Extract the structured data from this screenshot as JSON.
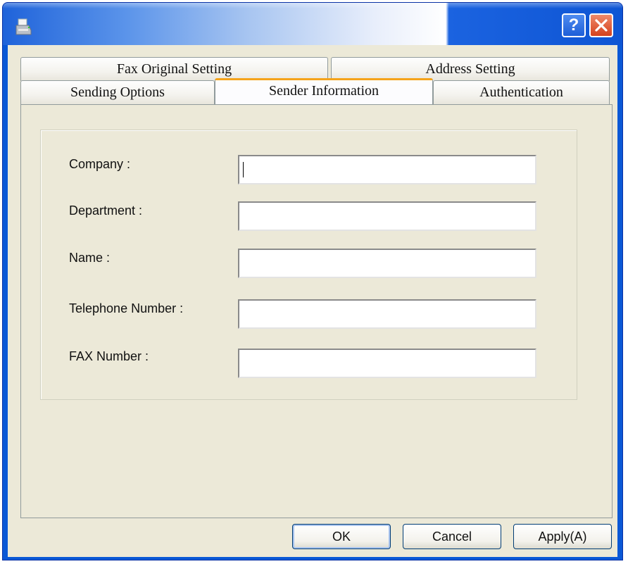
{
  "window": {
    "title": "",
    "icon": "printer-icon",
    "title_buttons": {
      "help": "?",
      "close": "close-icon"
    }
  },
  "tabs": {
    "row_back": [
      {
        "label": "Fax Original Setting"
      },
      {
        "label": "Address Setting"
      }
    ],
    "row_front": [
      {
        "label": "Sending Options"
      },
      {
        "label": "Sender Information",
        "active": true
      },
      {
        "label": "Authentication"
      }
    ]
  },
  "form": {
    "fields": [
      {
        "label": "Company :",
        "value": ""
      },
      {
        "label": "Department :",
        "value": ""
      },
      {
        "label": "Name :",
        "value": ""
      },
      {
        "label": "Telephone Number :",
        "value": ""
      },
      {
        "label": "FAX Number :",
        "value": ""
      }
    ]
  },
  "buttons": {
    "ok": "OK",
    "cancel": "Cancel",
    "apply": "Apply(A)"
  },
  "colors": {
    "titlebar": "#0a58d6",
    "active_tab_accent": "#f5a31a",
    "dialog_face": "#ece9d8",
    "close_button": "#d4411c"
  }
}
